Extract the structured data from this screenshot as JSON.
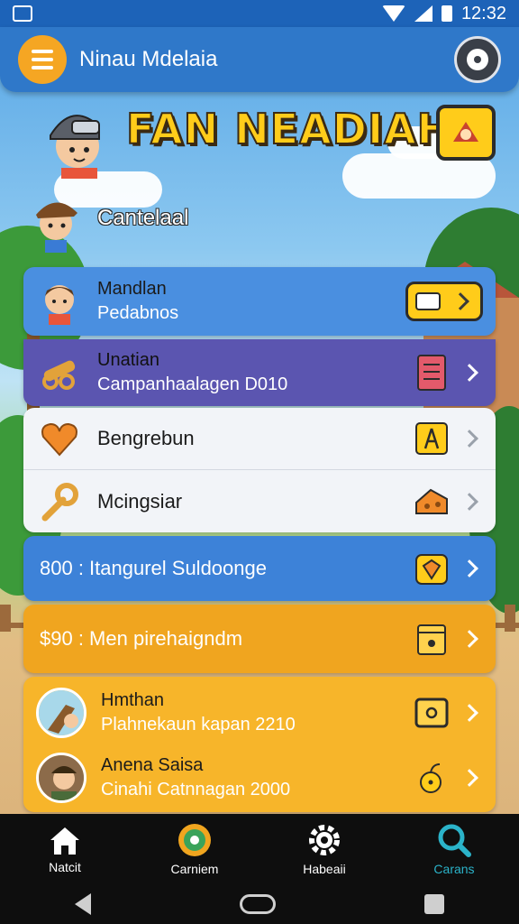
{
  "status_bar": {
    "time": "12:32"
  },
  "app_bar": {
    "title": "Ninau Mdelaia"
  },
  "hero": {
    "title": "FAN NEADIAH",
    "subtitle": "Cantelaal"
  },
  "rows": [
    {
      "title": "Mandlan",
      "subtitle": "Pedabnos"
    },
    {
      "title": "Unatian",
      "subtitle": "Campanhaalagen D010"
    },
    {
      "label": "Bengrebun"
    },
    {
      "label": "Mcingsiar"
    },
    {
      "label": "800 : Itangurel Suldoonge"
    },
    {
      "label": "$90 : Men pirehaigndm"
    },
    {
      "title": "Hmthan",
      "subtitle": "Plahnekaun kapan 2210"
    },
    {
      "title": "Anena Saisa",
      "subtitle": "Cinahi Catnnagan 2000"
    }
  ],
  "bottom_nav": [
    {
      "label": "Natcit",
      "icon": "home-icon"
    },
    {
      "label": "Carniem",
      "icon": "target-icon"
    },
    {
      "label": "Habeaii",
      "icon": "gear-icon"
    },
    {
      "label": "Carans",
      "icon": "search-icon",
      "active": true
    }
  ],
  "colors": {
    "appbar": "#2f78c9",
    "accent_orange": "#f5a623",
    "row_blue": "#4a8fe0",
    "row_purple": "#5b55b0",
    "row_gold": "#f0a51f",
    "active_tab": "#2bb3c9"
  }
}
